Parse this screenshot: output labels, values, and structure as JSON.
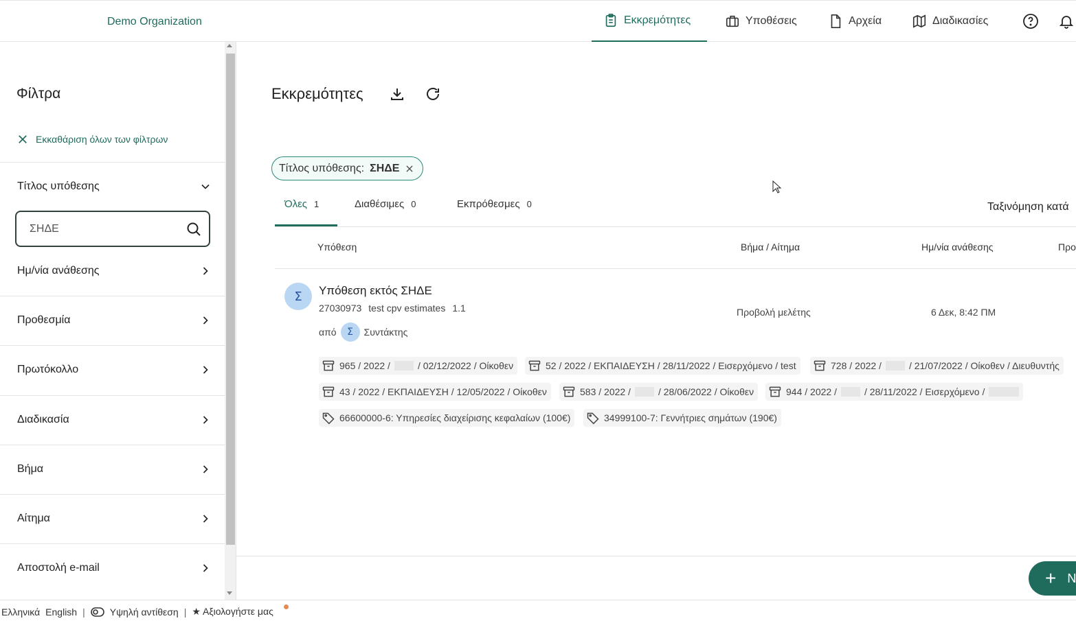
{
  "header": {
    "org": "Demo Organization",
    "nav": [
      {
        "label": "Εκκρεμότητες",
        "icon": "clipboard-icon"
      },
      {
        "label": "Υποθέσεις",
        "icon": "briefcase-icon"
      },
      {
        "label": "Αρχεία",
        "icon": "file-icon"
      },
      {
        "label": "Διαδικασίες",
        "icon": "map-icon"
      }
    ],
    "accent": "#1f6b5c"
  },
  "sidebar": {
    "title": "Φίλτρα",
    "clear_all": "Εκκαθάριση όλων των φίλτρων",
    "case_title_filter": "Τίτλος υπόθεσης",
    "search_value": "ΣΗΔΕ",
    "sections": [
      "Ημ/νία ανάθεσης",
      "Προθεσμία",
      "Πρωτόκολλο",
      "Διαδικασία",
      "Βήμα",
      "Αίτημα",
      "Αποστολή e-mail"
    ]
  },
  "main": {
    "title": "Εκκρεμότητες",
    "chip": {
      "label": "Τίτλος υπόθεσης:",
      "value": "ΣΗΔΕ"
    },
    "tabs": [
      {
        "label": "Όλες",
        "count": "1"
      },
      {
        "label": "Διαθέσιμες",
        "count": "0"
      },
      {
        "label": "Εκπρόθεσμες",
        "count": "0"
      }
    ],
    "sort_label": "Ταξινόμηση κατά",
    "columns": [
      "Υπόθεση",
      "Βήμα / Αίτημα",
      "Ημ/νία ανάθεσης",
      "Προ"
    ],
    "row": {
      "avatar": "Σ",
      "title": "Υπόθεση εκτός ΣΗΔΕ",
      "number": "27030973",
      "project": "test cpv estimates",
      "version": "1.1",
      "from_label": "από",
      "author_avatar": "Σ",
      "author": "Συντάκτης",
      "step": "Προβολή μελέτης",
      "date": "6 Δεκ, 8:42 ΠΜ",
      "protocols": [
        {
          "pre": "965 / 2022 /",
          "post": "/ 02/12/2022 / Οίκοθεν"
        },
        {
          "pre": "52 / 2022 / ΕΚΠΑΙΔΕΥΣΗ / 28/11/2022 / Εισερχόμενο / test",
          "post": ""
        },
        {
          "pre": "728 / 2022 /",
          "post": "/ 21/07/2022 / Οίκοθεν / Διευθυντής"
        },
        {
          "pre": "43 / 2022 / ΕΚΠΑΙΔΕΥΣΗ / 12/05/2022 / Οίκοθεν",
          "post": ""
        },
        {
          "pre": "583 / 2022 /",
          "post": "/ 28/06/2022 / Οίκοθεν"
        },
        {
          "pre": "944 / 2022 /",
          "post": "/ 28/11/2022 / Εισερχόμενο /"
        }
      ],
      "cpvs": [
        "66600000-6:  Υπηρεσίες διαχείρισης κεφαλαίων (100€)",
        "34999100-7:  Γεννήτριες σημάτων (190€)"
      ]
    },
    "fab_label": "Ν"
  },
  "footer": {
    "lang_el": "Ελληνικά",
    "lang_en": "English",
    "contrast": "Υψηλή αντίθεση",
    "rate": "★ Αξιολογήστε μας"
  }
}
